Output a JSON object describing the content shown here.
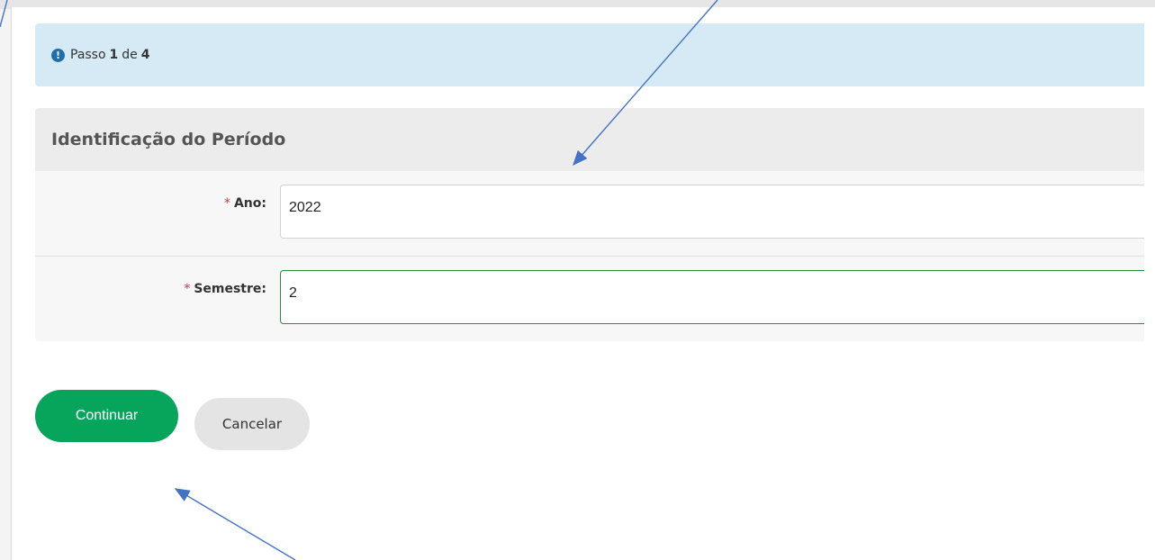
{
  "alert": {
    "icon": "info-icon",
    "prefix": "Passo",
    "current_step": "1",
    "connector": "de",
    "total_steps": "4"
  },
  "panel": {
    "title": "Identificação do Período",
    "fields": [
      {
        "required_mark": "*",
        "label": "Ano:",
        "value": "2022"
      },
      {
        "required_mark": "*",
        "label": "Semestre:",
        "value": "2"
      }
    ]
  },
  "actions": {
    "continue_label": "Continuar",
    "cancel_label": "Cancelar"
  },
  "colors": {
    "alert_bg": "#d6eaf6",
    "primary_button": "#07a55c",
    "required_mark": "#d9383a",
    "annotation_arrow": "#4472c4"
  }
}
